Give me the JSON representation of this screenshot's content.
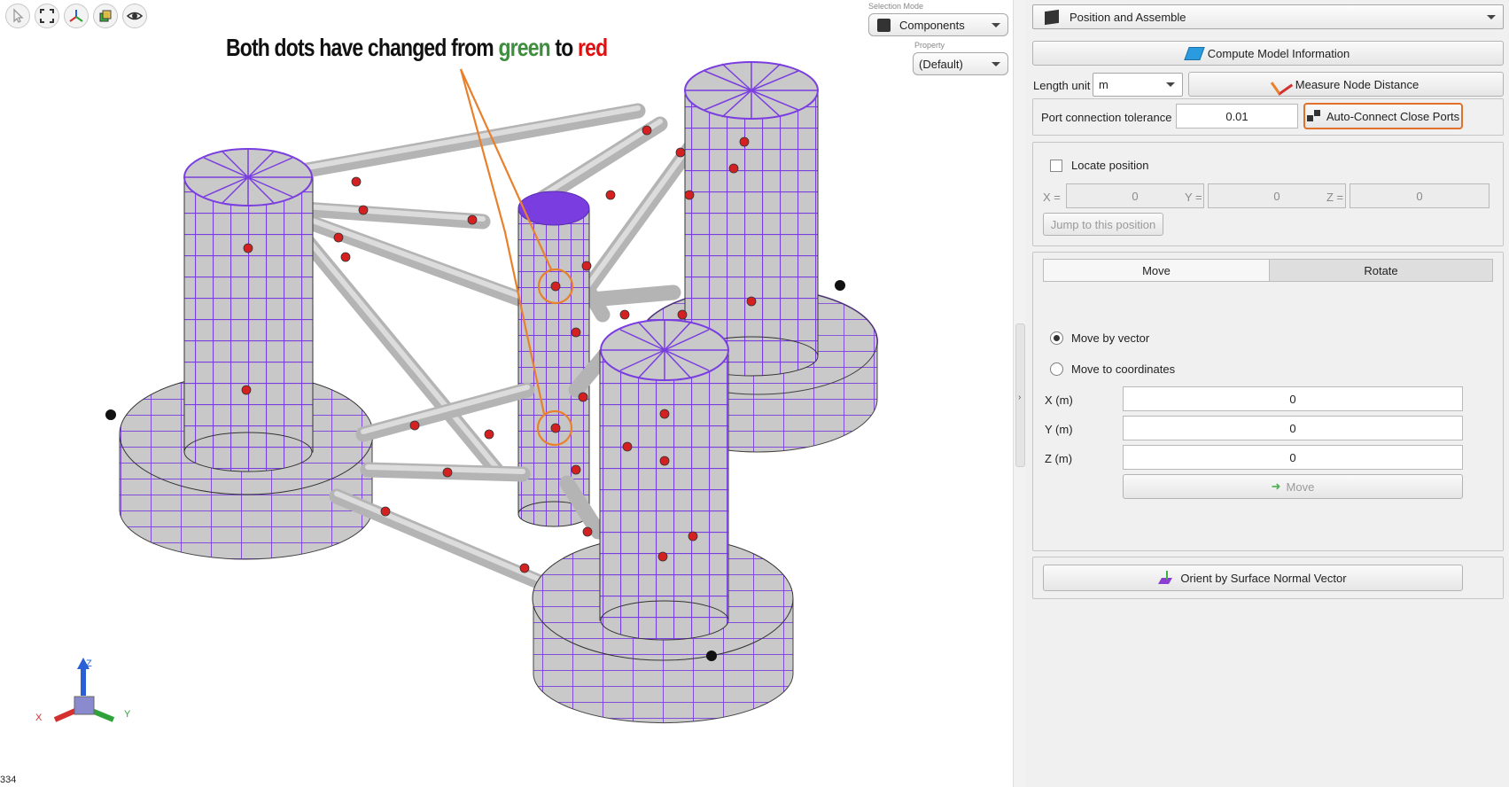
{
  "viewport": {
    "toolbar": [
      {
        "name": "select-arrow-icon"
      },
      {
        "name": "fit-view-icon"
      },
      {
        "name": "axes-orientation-icon"
      },
      {
        "name": "render-mode-cube-icon"
      },
      {
        "name": "visibility-eye-icon"
      }
    ],
    "annotation": {
      "prefix": "Both dots have changed from ",
      "green_word": "green",
      "middle": " to ",
      "red_word": "red",
      "green_color": "#3e8e3e",
      "red_color": "#e01010",
      "highlight_color": "#e8802c"
    },
    "selection_mode_label": "Selection Mode",
    "selection_mode_value": "Components",
    "property_label": "Property",
    "property_value": "(Default)",
    "frame_number": "334",
    "mesh_color": "#7a3de0",
    "port_color": "#d42020",
    "axes": {
      "z": "Z",
      "x": "X",
      "y": "Y"
    }
  },
  "panel": {
    "section_title": "Position and Assemble",
    "compute_label": "Compute Model Information",
    "length_unit_label": "Length unit",
    "length_unit_value": "m",
    "measure_label": "Measure Node Distance",
    "port_tol_label": "Port connection tolerance",
    "port_tol_value": "0.01",
    "auto_connect_label": "Auto-Connect Close Ports",
    "locate_label": "Locate position",
    "x_label": "X =",
    "x_value": "0",
    "y_label": "Y =",
    "y_value": "0",
    "z_label": "Z =",
    "z_value": "0",
    "jump_label": "Jump to this position",
    "tab_move": "Move",
    "tab_rotate": "Rotate",
    "move_by_vector": "Move by vector",
    "move_to_coords": "Move to coordinates",
    "xm_label": "X (m)",
    "xm_value": "0",
    "ym_label": "Y (m)",
    "ym_value": "0",
    "zm_label": "Z (m)",
    "zm_value": "0",
    "move_label": "Move",
    "orient_label": "Orient by Surface Normal Vector"
  }
}
